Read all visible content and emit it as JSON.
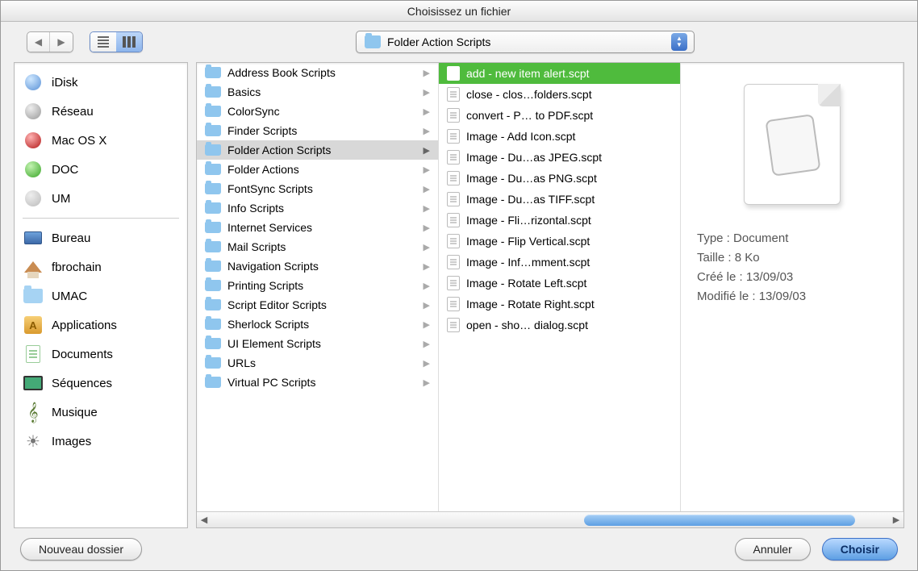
{
  "window": {
    "title": "Choisissez un fichier"
  },
  "path_popup": {
    "label": "Folder Action Scripts"
  },
  "sidebar": {
    "top": [
      {
        "label": "iDisk",
        "icon": "idisk"
      },
      {
        "label": "Réseau",
        "icon": "network"
      },
      {
        "label": "Mac OS X",
        "icon": "macosx"
      },
      {
        "label": "DOC",
        "icon": "doc"
      },
      {
        "label": "UM",
        "icon": "um"
      }
    ],
    "bottom": [
      {
        "label": "Bureau",
        "icon": "desktop"
      },
      {
        "label": "fbrochain",
        "icon": "home"
      },
      {
        "label": "UMAC",
        "icon": "folder"
      },
      {
        "label": "Applications",
        "icon": "apps"
      },
      {
        "label": "Documents",
        "icon": "docs"
      },
      {
        "label": "Séquences",
        "icon": "movies"
      },
      {
        "label": "Musique",
        "icon": "music"
      },
      {
        "label": "Images",
        "icon": "images"
      }
    ]
  },
  "column1": {
    "selected_index": 4,
    "items": [
      "Address Book Scripts",
      "Basics",
      "ColorSync",
      "Finder Scripts",
      "Folder Action Scripts",
      "Folder Actions",
      "FontSync Scripts",
      "Info Scripts",
      "Internet Services",
      "Mail Scripts",
      "Navigation Scripts",
      "Printing Scripts",
      "Script Editor Scripts",
      "Sherlock Scripts",
      "UI Element Scripts",
      "URLs",
      "Virtual PC Scripts"
    ]
  },
  "column2": {
    "selected_index": 0,
    "items": [
      "add - new item alert.scpt",
      "close - clos…folders.scpt",
      "convert - P… to PDF.scpt",
      "Image - Add Icon.scpt",
      "Image - Du…as JPEG.scpt",
      "Image - Du…as PNG.scpt",
      "Image - Du…as TIFF.scpt",
      "Image - Fli…rizontal.scpt",
      "Image - Flip Vertical.scpt",
      "Image - Inf…mment.scpt",
      "Image - Rotate Left.scpt",
      "Image - Rotate Right.scpt",
      "open - sho… dialog.scpt"
    ]
  },
  "preview": {
    "type_label": "Type : ",
    "type_value": "Document",
    "size_label": "Taille : ",
    "size_value": "8 Ko",
    "created_label": "Créé le : ",
    "created_value": "13/09/03",
    "modified_label": "Modifié le : ",
    "modified_value": "13/09/03"
  },
  "footer": {
    "new_folder": "Nouveau dossier",
    "cancel": "Annuler",
    "choose": "Choisir"
  }
}
